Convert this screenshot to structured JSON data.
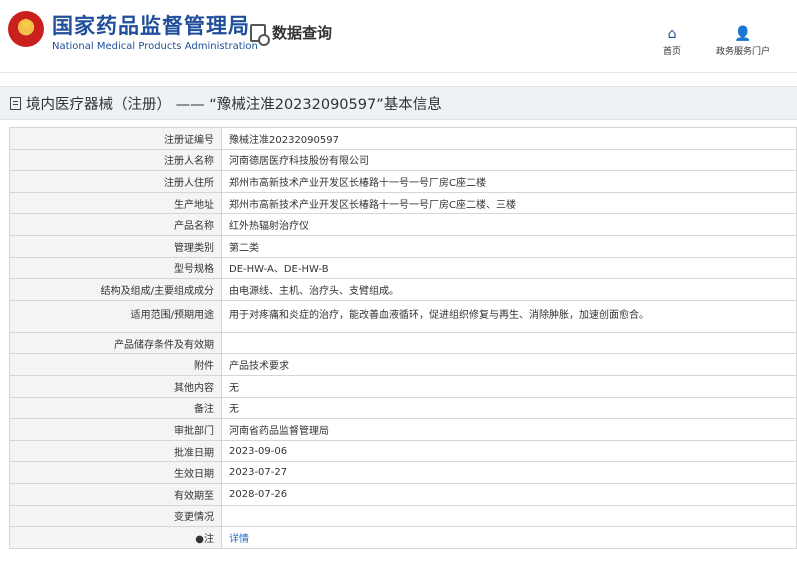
{
  "header": {
    "brand_cn": "国家药品监督管理局",
    "brand_en": "National Medical Products Administration",
    "query_label": "数据查询",
    "nav": {
      "home": "首页",
      "portal": "政务服务门户"
    }
  },
  "page_title": "境内医疗器械（注册） —— “豫械注准20232090597”基本信息",
  "colors": {
    "brand": "#1f4e9a",
    "label_bg": "#f3f4f6",
    "link": "#2b6cc4"
  },
  "rows": [
    {
      "label": "注册证编号",
      "value": "豫械注准20232090597"
    },
    {
      "label": "注册人名称",
      "value": "河南德居医疗科技股份有限公司"
    },
    {
      "label": "注册人住所",
      "value": "郑州市高新技术产业开发区长椿路十一号一号厂房C座二楼"
    },
    {
      "label": "生产地址",
      "value": "郑州市高新技术产业开发区长椿路十一号一号厂房C座二楼、三楼"
    },
    {
      "label": "产品名称",
      "value": "红外热辐射治疗仪"
    },
    {
      "label": "管理类别",
      "value": "第二类"
    },
    {
      "label": "型号规格",
      "value": "DE-HW-A、DE-HW-B"
    },
    {
      "label": "结构及组成/主要组成成分",
      "value": "由电源线、主机、治疗头、支臂组成。"
    },
    {
      "label": "适用范围/预期用途",
      "value": "用于对疼痛和炎症的治疗，能改善血液循环，促进组织修复与再生、消除肿胀，加速创面愈合。"
    },
    {
      "label": "产品储存条件及有效期",
      "value": ""
    },
    {
      "label": "附件",
      "value": "产品技术要求"
    },
    {
      "label": "其他内容",
      "value": "无"
    },
    {
      "label": "备注",
      "value": "无"
    },
    {
      "label": "审批部门",
      "value": "河南省药品监督管理局"
    },
    {
      "label": "批准日期",
      "value": "2023-09-06"
    },
    {
      "label": "生效日期",
      "value": "2023-07-27"
    },
    {
      "label": "有效期至",
      "value": "2028-07-26"
    },
    {
      "label": "变更情况",
      "value": ""
    },
    {
      "label": "●注",
      "value": "详情",
      "link": true
    }
  ]
}
